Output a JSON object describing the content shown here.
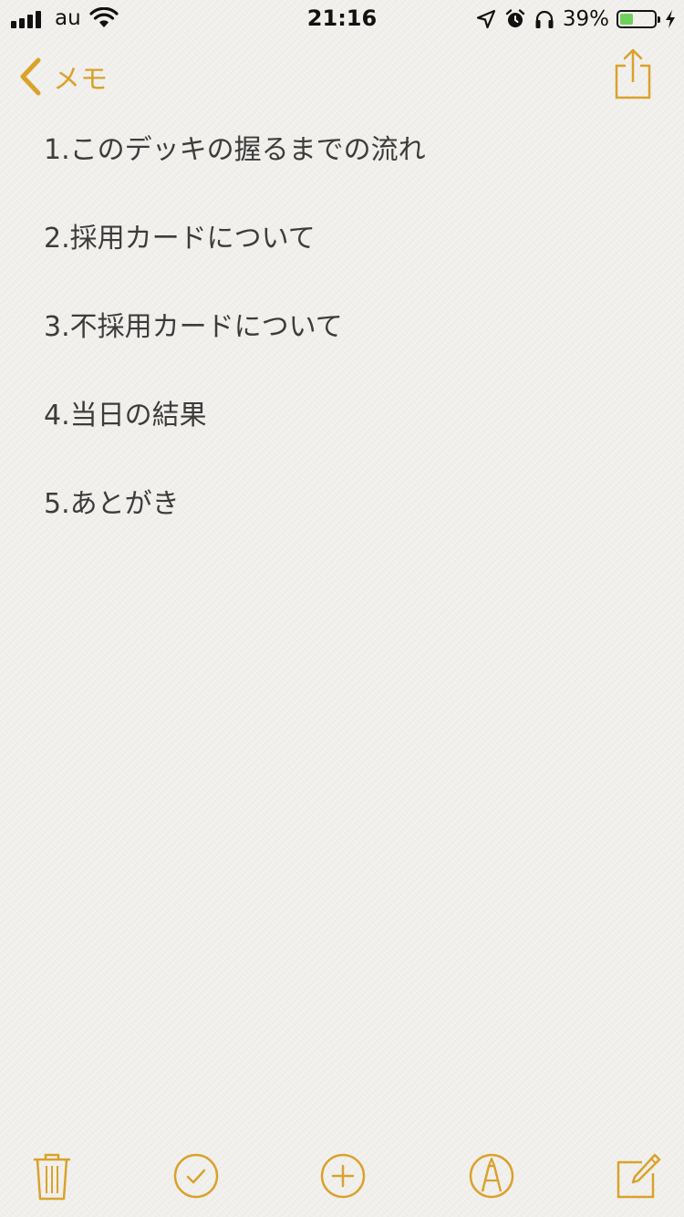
{
  "status_bar": {
    "carrier": "au",
    "time": "21:16",
    "battery_percent": "39%",
    "battery_level": 0.39,
    "icons": [
      "signal-icon",
      "wifi-icon",
      "location-arrow-icon",
      "alarm-icon",
      "headphones-icon",
      "battery-icon",
      "charging-bolt-icon"
    ]
  },
  "nav": {
    "back_label": "メモ",
    "back_icon": "chevron-left-icon",
    "share_icon": "share-icon"
  },
  "note": {
    "lines": [
      "1.このデッキの握るまでの流れ",
      "2.採用カードについて",
      "3.不採用カードについて",
      "4.当日の結果",
      "5.あとがき"
    ]
  },
  "toolbar": {
    "items": [
      "trash-icon",
      "checklist-icon",
      "add-icon",
      "markup-icon",
      "compose-icon"
    ]
  },
  "colors": {
    "accent": "#d9a22b",
    "text": "#3c3c3c",
    "background": "#f3f2ef",
    "battery_fill": "#6fcf5c"
  }
}
